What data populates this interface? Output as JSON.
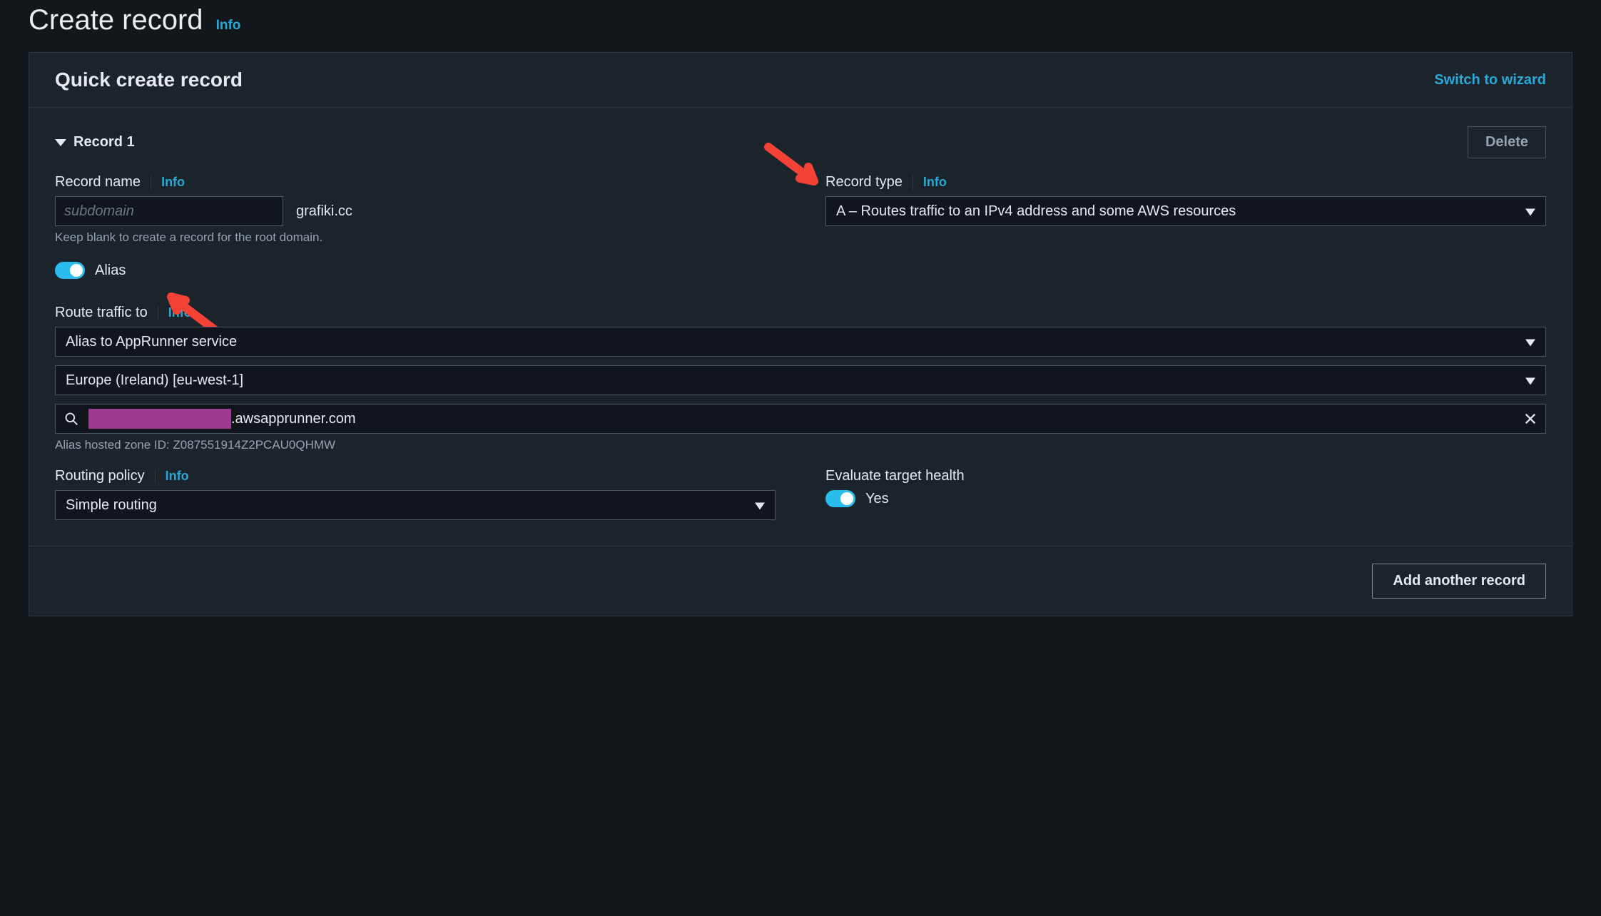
{
  "header": {
    "title": "Create record",
    "info": "Info"
  },
  "panel": {
    "title": "Quick create record",
    "switch_link": "Switch to wizard"
  },
  "record": {
    "title": "Record 1",
    "delete": "Delete",
    "name": {
      "label": "Record name",
      "info": "Info",
      "placeholder": "subdomain",
      "value": "",
      "suffix": "grafiki.cc",
      "hint": "Keep blank to create a record for the root domain."
    },
    "type": {
      "label": "Record type",
      "info": "Info",
      "value": "A – Routes traffic to an IPv4 address and some AWS resources"
    },
    "alias": {
      "on": true,
      "label": "Alias"
    },
    "route": {
      "label": "Route traffic to",
      "info": "Info",
      "alias_to": "Alias to AppRunner service",
      "region": "Europe (Ireland) [eu-west-1]",
      "endpoint_redacted": true,
      "endpoint_suffix": ".awsapprunner.com",
      "hosted_zone_label": "Alias hosted zone ID:",
      "hosted_zone_id": "Z087551914Z2PCAU0QHMW"
    },
    "routing_policy": {
      "label": "Routing policy",
      "info": "Info",
      "value": "Simple routing"
    },
    "evaluate_health": {
      "label": "Evaluate target health",
      "on": true,
      "value_label": "Yes"
    }
  },
  "actions": {
    "add_another": "Add another record"
  }
}
